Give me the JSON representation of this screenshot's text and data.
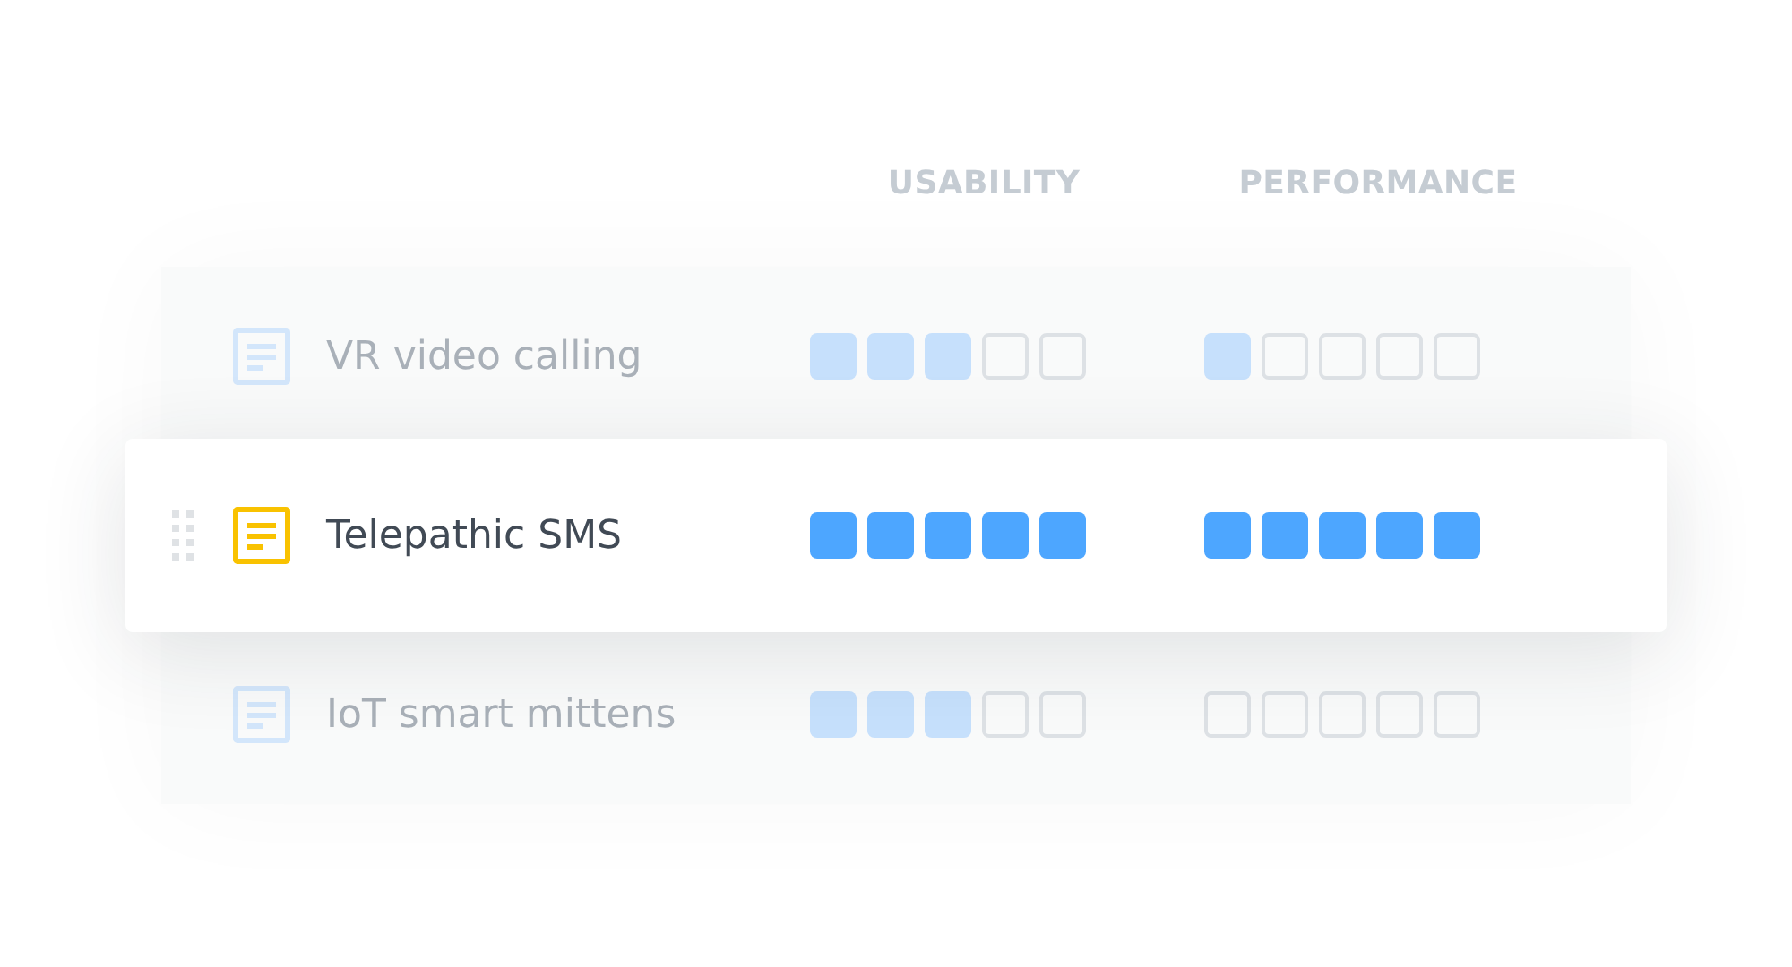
{
  "columns": [
    "USABILITY",
    "PERFORMANCE"
  ],
  "rows": [
    {
      "name": "VR video calling",
      "dragging": false,
      "ratings": [
        {
          "stars": 3
        },
        {
          "stars": 1
        }
      ]
    },
    {
      "name": "Telepathic SMS",
      "dragging": true,
      "ratings": [
        {
          "stars": 5
        },
        {
          "stars": 5
        }
      ]
    },
    {
      "name": "IoT smart mittens",
      "dragging": false,
      "ratings": [
        {
          "stars": 3
        },
        {
          "stars": 0
        }
      ]
    }
  ]
}
